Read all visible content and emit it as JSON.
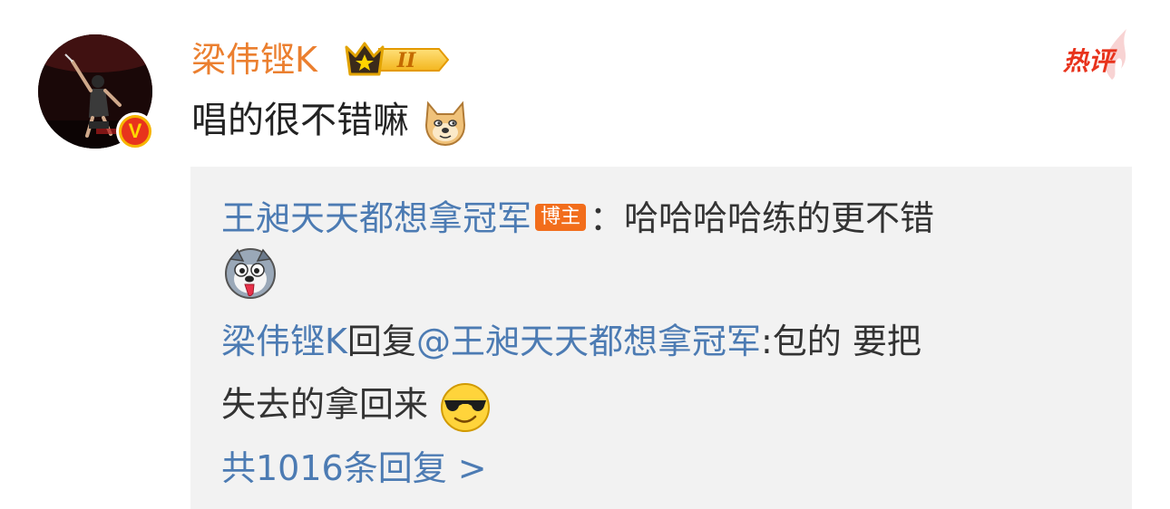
{
  "user": {
    "name": "梁伟铿K",
    "vip_level": "II",
    "verified_icon": "verified-v-icon"
  },
  "hot_tag": "热评",
  "comment": {
    "text": "唱的很不错嘛",
    "emoji": "doge-emoji"
  },
  "replies": [
    {
      "author": "王昶天天都想拿冠军",
      "badge": "博主",
      "separator": "：",
      "text": "哈哈哈哈练的更不错",
      "emoji": "husky-emoji"
    },
    {
      "author": "梁伟铿K",
      "reply_word": "回复",
      "mention": "@王昶天天都想拿冠军",
      "text_line1": ":包的 要把",
      "text_line2": "失去的拿回来",
      "emoji": "sunglasses-emoji"
    }
  ],
  "more_replies": "共1016条回复 >"
}
